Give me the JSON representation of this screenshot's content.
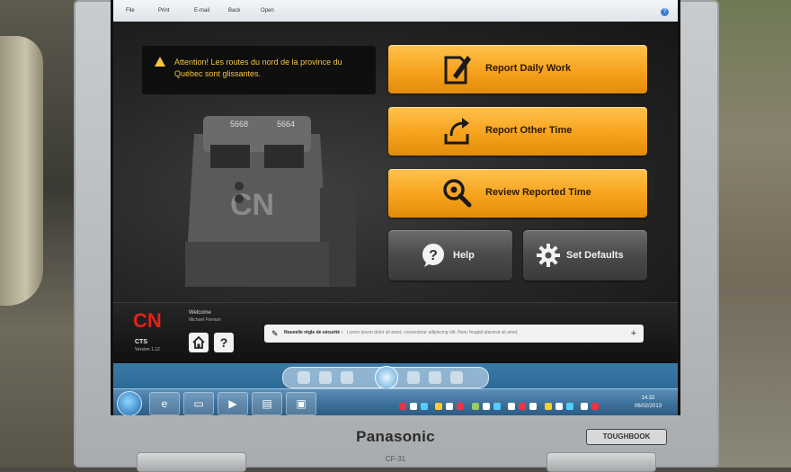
{
  "device": {
    "brand": "Panasonic",
    "model": "CF-31",
    "badge": "TOUGHBOOK"
  },
  "browser": {
    "menu": [
      "File",
      "Print",
      "E-mail",
      "Back",
      "Open"
    ]
  },
  "app": {
    "alert_text": "Attention! Les routes du nord de la province du Québec sont glissantes.",
    "buttons": {
      "report_daily_work": "Report Daily Work",
      "report_other_time": "Report Other Time",
      "review_reported_time": "Review Reported Time",
      "help": "Help",
      "set_defaults": "Set Defaults"
    },
    "locomotive_numbers": [
      "5668",
      "5664"
    ],
    "footer": {
      "logo": "CN",
      "welcome": "Welcome",
      "user": "Michael Forman",
      "app_name": "CTS",
      "version": "Version 1.12",
      "news_title": "Nouvelle règle de sécurité :",
      "news_text": "Lorem ipsum dolor sit amet, consectetur adipiscing elit. Nunc feugiat placerat sit amet.",
      "add_symbol": "+"
    }
  },
  "taskbar": {
    "time": "14:32",
    "date": "06/02/2013"
  },
  "colors": {
    "accent_orange": "#f6a21c",
    "alert_yellow": "#f5c542",
    "cn_red": "#e0231a"
  }
}
